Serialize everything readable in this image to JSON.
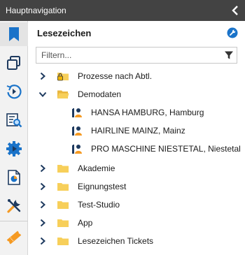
{
  "window": {
    "title": "Hauptnavigation"
  },
  "panel": {
    "title": "Lesezeichen",
    "filter_placeholder": "Filtern..."
  },
  "rail": {
    "items": [
      {
        "icon": "bookmark-icon",
        "active": true
      },
      {
        "icon": "windows-icon"
      },
      {
        "icon": "history-icon"
      },
      {
        "icon": "search-list-icon"
      },
      {
        "icon": "process-gear-icon"
      },
      {
        "icon": "report-icon"
      },
      {
        "icon": "tools-icon"
      },
      {
        "icon": "ticket-icon"
      }
    ]
  },
  "tree": [
    {
      "label": "Prozesse nach Abtl.",
      "level": 0,
      "expanded": false,
      "icon": "locked-folder-icon"
    },
    {
      "label": "Demodaten",
      "level": 0,
      "expanded": true,
      "icon": "folder-open-icon"
    },
    {
      "label": "HANSA HAMBURG, Hamburg",
      "level": 1,
      "icon": "contact-icon"
    },
    {
      "label": "HAIRLINE MAINZ, Mainz",
      "level": 1,
      "icon": "contact-icon"
    },
    {
      "label": "PRO MASCHINE NIESTETAL, Niestetal",
      "level": 1,
      "icon": "contact-icon"
    },
    {
      "label": "Akademie",
      "level": 0,
      "expanded": false,
      "icon": "folder-icon"
    },
    {
      "label": "Eignungstest",
      "level": 0,
      "expanded": false,
      "icon": "folder-icon"
    },
    {
      "label": "Test-Studio",
      "level": 0,
      "expanded": false,
      "icon": "folder-icon"
    },
    {
      "label": "App",
      "level": 0,
      "expanded": false,
      "icon": "folder-icon"
    },
    {
      "label": "Lesezeichen Tickets",
      "level": 0,
      "expanded": false,
      "icon": "folder-icon"
    }
  ],
  "colors": {
    "accent": "#1a73c9",
    "folder": "#f7cf5a",
    "chevron": "#1e3a5f",
    "titlebar": "#434343"
  }
}
